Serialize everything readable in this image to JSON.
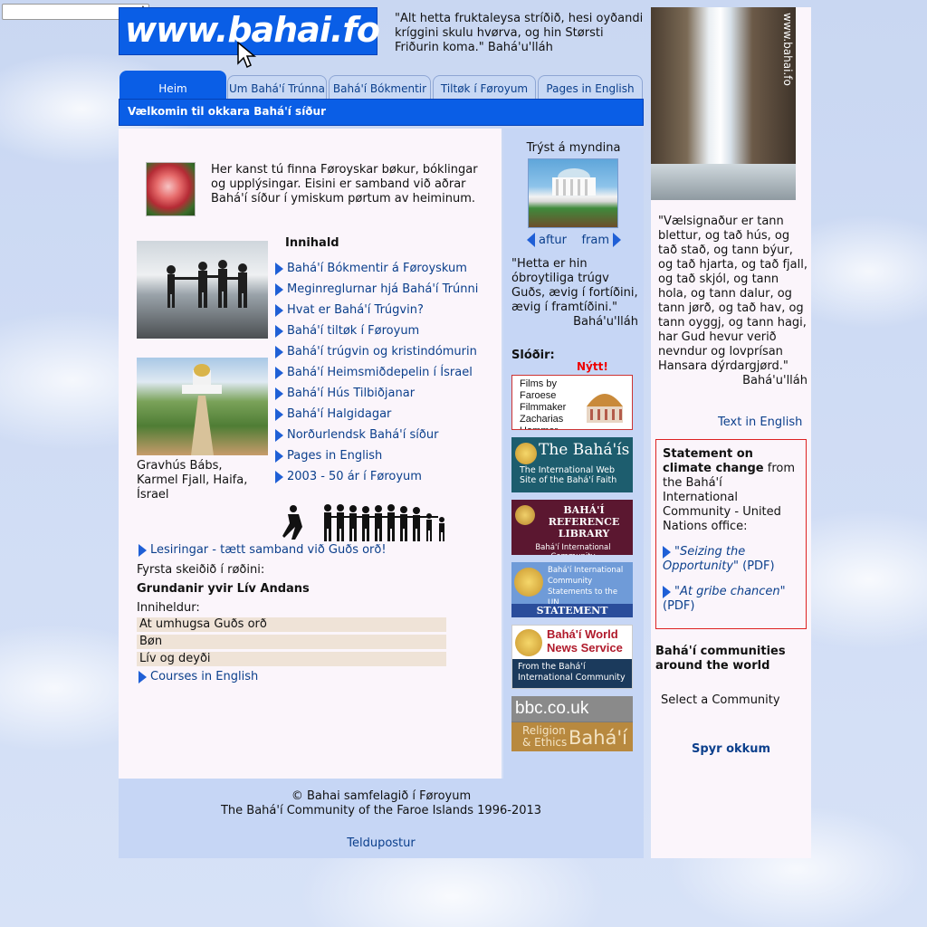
{
  "header": {
    "logo_text": "www.bahai.fo",
    "quote": "\"Alt hetta fruktaleysa stríðið, hesi oyðandi kríggini skulu hvørva, og hin Størsti Friðurin koma.\"  Bahá'u'lláh"
  },
  "tabs": [
    {
      "label": "Heim"
    },
    {
      "label": "Um Bahá'í Trúnna"
    },
    {
      "label": "Bahá'í Bókmentir"
    },
    {
      "label": "Tiltøk í Føroyum"
    },
    {
      "label": "Pages in English"
    }
  ],
  "welcome_bar": "Vælkomin til okkara Bahá'í síður",
  "intro_text": "Her kanst tú finna Føroyskar bøkur, bóklingar og upplýsingar. Eisini er samband við aðrar Bahá'í síður í ymiskum pørtum av heiminum.",
  "image_caption": "Gravhús Bábs, Karmel Fjall, Haifa, Ísrael",
  "contents": {
    "heading": "Innihald",
    "items": [
      "Bahá'í Bókmentir á Føroyskum",
      "Meginreglurnar hjá Bahá'í Trúnni",
      "Hvat er Bahá'í Trúgvin?",
      "Bahá'í tiltøk í Føroyum",
      "Bahá'í trúgvin og kristindómurin",
      "Bahá'í Heimsmiðdepelin í Ísrael",
      "Bahá'í Hús Tilbiðjanar",
      "Bahá'í Halgidagar",
      "Norðurlendsk Bahá'í síður",
      "Pages in English",
      "2003 - 50 ár í Føroyum"
    ]
  },
  "study": {
    "link": "Lesiringar - tætt samband við Guðs orð!",
    "first_step": "Fyrsta skeiðið í røðini:",
    "title": "Grundanir yvir Lív Andans",
    "contains": "Inniheldur:",
    "units": [
      "At umhugsa Guðs orð",
      "Bøn",
      "Lív og deyði"
    ],
    "courses_link": "Courses in English"
  },
  "middle": {
    "click_image": "Trýst á myndina",
    "back": "aftur",
    "forward": "fram",
    "quote": "\"Hetta er hin óbroytiliga trúgv Guðs, ævig í fortíðini, ævig í framtíðini.\"",
    "quote_attr": "Bahá'u'lláh",
    "links_heading": "Slóðir:",
    "new_badge": "Nýtt!",
    "banners": {
      "films": "Films by Faroese Filmmaker Zacharias Hammer",
      "bahais_title": "The Bahá'ís",
      "bahais_sub": "The International Web Site of the Bahá'í Faith",
      "ref_title": "BAHÁ'Í REFERENCE LIBRARY",
      "ref_sub": "Bahá'í International Community",
      "un_title": "Bahá'í International Community Statements to the UN",
      "un_sub": "STATEMENT LIBRARY",
      "news_title": "Bahá'í World News Service",
      "news_sub": "From the Bahá'í International Community",
      "bbc_title": "bbc.co.uk",
      "bbc_left": "Religion & Ethics",
      "bbc_right": "Bahá'í"
    }
  },
  "footer": {
    "copyright": "© Bahai samfelagið í Føroyum",
    "community": "The Bahá'í Community of the Faroe Islands 1996-2013",
    "email": "Teldupostur"
  },
  "right": {
    "photo_watermark": "www.bahai.fo",
    "quote": "\"Vælsignaður er tann blettur, og tað hús, og tað stað, og tann býur, og tað hjarta, og tað fjall, og tað skjól, og tann hola, og tann dalur, og tann jørð, og tað hav, og tann oyggj, og tann hagi, har Gud hevur verið nevndur og lovprísan Hansara dýrdargjørd.\"",
    "quote_attr": "Bahá'u'lláh",
    "text_english": "Text in English",
    "climate_bold": "Statement on climate change",
    "climate_rest": " from the Bahá'í International Community - United Nations office:",
    "climate_link1": "\"Seizing the Opportunity\"",
    "climate_link2": "\"At gribe chancen\"",
    "pdf": "(PDF)",
    "communities_heading": "Bahá'í communities around the world",
    "select_community": "Select a Community",
    "ask_us": "Spyr okkum"
  }
}
